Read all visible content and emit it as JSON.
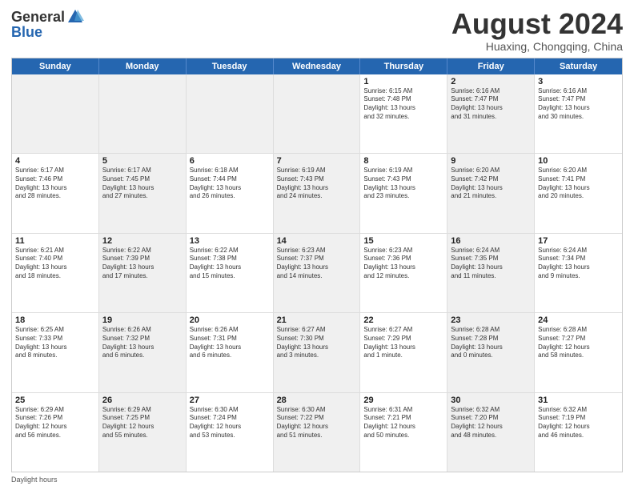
{
  "logo": {
    "general": "General",
    "blue": "Blue"
  },
  "title": "August 2024",
  "subtitle": "Huaxing, Chongqing, China",
  "days_of_week": [
    "Sunday",
    "Monday",
    "Tuesday",
    "Wednesday",
    "Thursday",
    "Friday",
    "Saturday"
  ],
  "footer_label": "Daylight hours",
  "weeks": [
    [
      {
        "day": "",
        "info": "",
        "shaded": true
      },
      {
        "day": "",
        "info": "",
        "shaded": true
      },
      {
        "day": "",
        "info": "",
        "shaded": true
      },
      {
        "day": "",
        "info": "",
        "shaded": true
      },
      {
        "day": "1",
        "info": "Sunrise: 6:15 AM\nSunset: 7:48 PM\nDaylight: 13 hours\nand 32 minutes.",
        "shaded": false
      },
      {
        "day": "2",
        "info": "Sunrise: 6:16 AM\nSunset: 7:47 PM\nDaylight: 13 hours\nand 31 minutes.",
        "shaded": true
      },
      {
        "day": "3",
        "info": "Sunrise: 6:16 AM\nSunset: 7:47 PM\nDaylight: 13 hours\nand 30 minutes.",
        "shaded": false
      }
    ],
    [
      {
        "day": "4",
        "info": "Sunrise: 6:17 AM\nSunset: 7:46 PM\nDaylight: 13 hours\nand 28 minutes.",
        "shaded": false
      },
      {
        "day": "5",
        "info": "Sunrise: 6:17 AM\nSunset: 7:45 PM\nDaylight: 13 hours\nand 27 minutes.",
        "shaded": true
      },
      {
        "day": "6",
        "info": "Sunrise: 6:18 AM\nSunset: 7:44 PM\nDaylight: 13 hours\nand 26 minutes.",
        "shaded": false
      },
      {
        "day": "7",
        "info": "Sunrise: 6:19 AM\nSunset: 7:43 PM\nDaylight: 13 hours\nand 24 minutes.",
        "shaded": true
      },
      {
        "day": "8",
        "info": "Sunrise: 6:19 AM\nSunset: 7:43 PM\nDaylight: 13 hours\nand 23 minutes.",
        "shaded": false
      },
      {
        "day": "9",
        "info": "Sunrise: 6:20 AM\nSunset: 7:42 PM\nDaylight: 13 hours\nand 21 minutes.",
        "shaded": true
      },
      {
        "day": "10",
        "info": "Sunrise: 6:20 AM\nSunset: 7:41 PM\nDaylight: 13 hours\nand 20 minutes.",
        "shaded": false
      }
    ],
    [
      {
        "day": "11",
        "info": "Sunrise: 6:21 AM\nSunset: 7:40 PM\nDaylight: 13 hours\nand 18 minutes.",
        "shaded": false
      },
      {
        "day": "12",
        "info": "Sunrise: 6:22 AM\nSunset: 7:39 PM\nDaylight: 13 hours\nand 17 minutes.",
        "shaded": true
      },
      {
        "day": "13",
        "info": "Sunrise: 6:22 AM\nSunset: 7:38 PM\nDaylight: 13 hours\nand 15 minutes.",
        "shaded": false
      },
      {
        "day": "14",
        "info": "Sunrise: 6:23 AM\nSunset: 7:37 PM\nDaylight: 13 hours\nand 14 minutes.",
        "shaded": true
      },
      {
        "day": "15",
        "info": "Sunrise: 6:23 AM\nSunset: 7:36 PM\nDaylight: 13 hours\nand 12 minutes.",
        "shaded": false
      },
      {
        "day": "16",
        "info": "Sunrise: 6:24 AM\nSunset: 7:35 PM\nDaylight: 13 hours\nand 11 minutes.",
        "shaded": true
      },
      {
        "day": "17",
        "info": "Sunrise: 6:24 AM\nSunset: 7:34 PM\nDaylight: 13 hours\nand 9 minutes.",
        "shaded": false
      }
    ],
    [
      {
        "day": "18",
        "info": "Sunrise: 6:25 AM\nSunset: 7:33 PM\nDaylight: 13 hours\nand 8 minutes.",
        "shaded": false
      },
      {
        "day": "19",
        "info": "Sunrise: 6:26 AM\nSunset: 7:32 PM\nDaylight: 13 hours\nand 6 minutes.",
        "shaded": true
      },
      {
        "day": "20",
        "info": "Sunrise: 6:26 AM\nSunset: 7:31 PM\nDaylight: 13 hours\nand 6 minutes.",
        "shaded": false
      },
      {
        "day": "21",
        "info": "Sunrise: 6:27 AM\nSunset: 7:30 PM\nDaylight: 13 hours\nand 3 minutes.",
        "shaded": true
      },
      {
        "day": "22",
        "info": "Sunrise: 6:27 AM\nSunset: 7:29 PM\nDaylight: 13 hours\nand 1 minute.",
        "shaded": false
      },
      {
        "day": "23",
        "info": "Sunrise: 6:28 AM\nSunset: 7:28 PM\nDaylight: 13 hours\nand 0 minutes.",
        "shaded": true
      },
      {
        "day": "24",
        "info": "Sunrise: 6:28 AM\nSunset: 7:27 PM\nDaylight: 12 hours\nand 58 minutes.",
        "shaded": false
      }
    ],
    [
      {
        "day": "25",
        "info": "Sunrise: 6:29 AM\nSunset: 7:26 PM\nDaylight: 12 hours\nand 56 minutes.",
        "shaded": false
      },
      {
        "day": "26",
        "info": "Sunrise: 6:29 AM\nSunset: 7:25 PM\nDaylight: 12 hours\nand 55 minutes.",
        "shaded": true
      },
      {
        "day": "27",
        "info": "Sunrise: 6:30 AM\nSunset: 7:24 PM\nDaylight: 12 hours\nand 53 minutes.",
        "shaded": false
      },
      {
        "day": "28",
        "info": "Sunrise: 6:30 AM\nSunset: 7:22 PM\nDaylight: 12 hours\nand 51 minutes.",
        "shaded": true
      },
      {
        "day": "29",
        "info": "Sunrise: 6:31 AM\nSunset: 7:21 PM\nDaylight: 12 hours\nand 50 minutes.",
        "shaded": false
      },
      {
        "day": "30",
        "info": "Sunrise: 6:32 AM\nSunset: 7:20 PM\nDaylight: 12 hours\nand 48 minutes.",
        "shaded": true
      },
      {
        "day": "31",
        "info": "Sunrise: 6:32 AM\nSunset: 7:19 PM\nDaylight: 12 hours\nand 46 minutes.",
        "shaded": false
      }
    ]
  ]
}
